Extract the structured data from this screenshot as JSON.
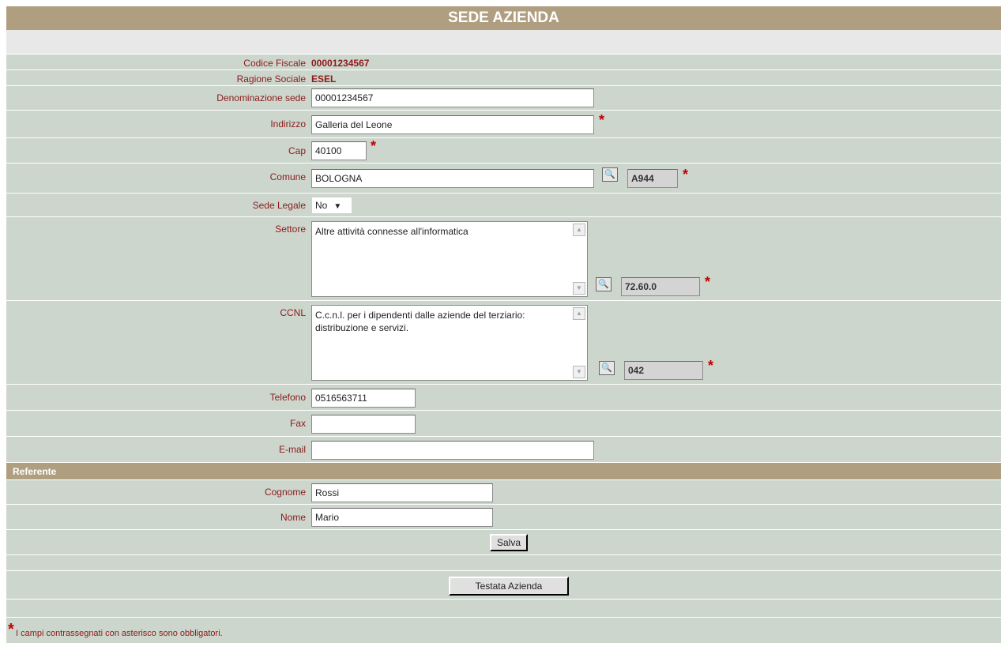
{
  "header": {
    "title": "SEDE AZIENDA"
  },
  "fields": {
    "codice_fiscale": {
      "label": "Codice Fiscale",
      "value": "00001234567"
    },
    "ragione_sociale": {
      "label": "Ragione Sociale",
      "value": "ESEL"
    },
    "denominazione": {
      "label": "Denominazione sede",
      "value": "00001234567"
    },
    "indirizzo": {
      "label": "Indirizzo",
      "value": "Galleria del Leone"
    },
    "cap": {
      "label": "Cap",
      "value": "40100"
    },
    "comune": {
      "label": "Comune",
      "value": "BOLOGNA",
      "code": "A944"
    },
    "sede_legale": {
      "label": "Sede Legale",
      "value": "No"
    },
    "settore": {
      "label": "Settore",
      "value": "Altre attività connesse all'informatica",
      "code": "72.60.0"
    },
    "ccnl": {
      "label": "CCNL",
      "value": "C.c.n.l. per i dipendenti dalle aziende del terziario: distribuzione e servizi.",
      "code": "042"
    },
    "telefono": {
      "label": "Telefono",
      "value": "0516563711"
    },
    "fax": {
      "label": "Fax",
      "value": ""
    },
    "email": {
      "label": "E-mail",
      "value": ""
    }
  },
  "referente": {
    "title": "Referente",
    "cognome": {
      "label": "Cognome",
      "value": "Rossi"
    },
    "nome": {
      "label": "Nome",
      "value": "Mario"
    }
  },
  "buttons": {
    "salva": "Salva",
    "testata": "Testata Azienda"
  },
  "footer": {
    "star": "*",
    "note": "I campi contrassegnati con asterisco sono obbligatori."
  },
  "colors": {
    "header_bg": "#b09e80",
    "row_bg": "#cdd6cd",
    "label_text": "#8b1a1a",
    "required_star": "#c00000"
  }
}
